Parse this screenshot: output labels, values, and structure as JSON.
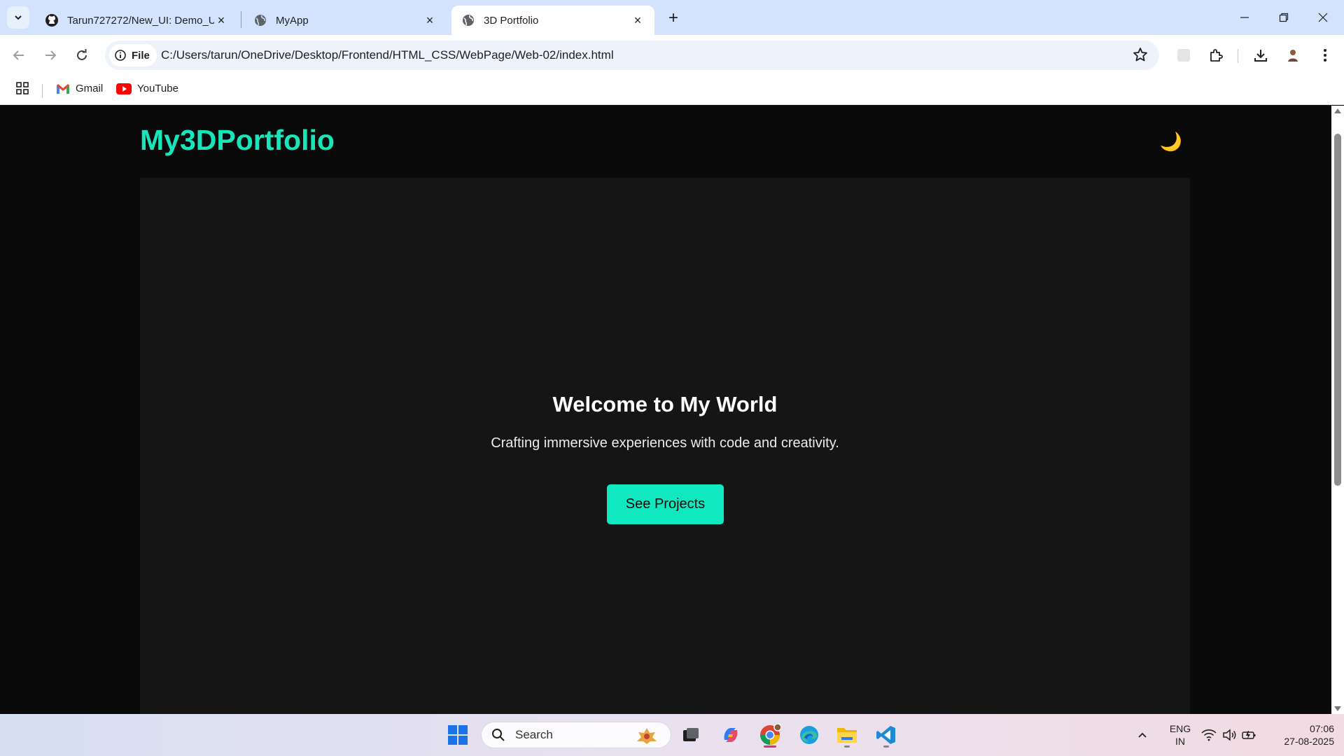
{
  "browser": {
    "tabs": [
      {
        "title": "Tarun727272/New_UI: Demo_UI",
        "favicon": "github-icon",
        "active": false
      },
      {
        "title": "MyApp",
        "favicon": "globe-icon",
        "active": false
      },
      {
        "title": "3D Portfolio",
        "favicon": "globe-icon",
        "active": true
      }
    ],
    "address": {
      "chip_label": "File",
      "url": "C:/Users/tarun/OneDrive/Desktop/Frontend/HTML_CSS/WebPage/Web-02/index.html"
    },
    "bookmarks": [
      {
        "label": "Gmail",
        "icon": "gmail-icon"
      },
      {
        "label": "YouTube",
        "icon": "youtube-icon"
      }
    ]
  },
  "page": {
    "brand": "My3DPortfolio",
    "theme_toggle_icon": "🌙",
    "hero": {
      "title": "Welcome to My World",
      "subtitle": "Crafting immersive experiences with code and creativity.",
      "cta_label": "See Projects"
    },
    "colors": {
      "accent": "#16e6b9",
      "background": "#0a0a0a",
      "hero_bg": "#151515"
    }
  },
  "taskbar": {
    "search_placeholder": "Search",
    "apps": [
      "start-icon",
      "search",
      "task-view-icon",
      "copilot-icon",
      "chrome-icon",
      "edge-icon",
      "file-explorer-icon",
      "vscode-icon"
    ],
    "lang_line1": "ENG",
    "lang_line2": "IN",
    "time": "07:06",
    "date": "27-08-2025"
  }
}
